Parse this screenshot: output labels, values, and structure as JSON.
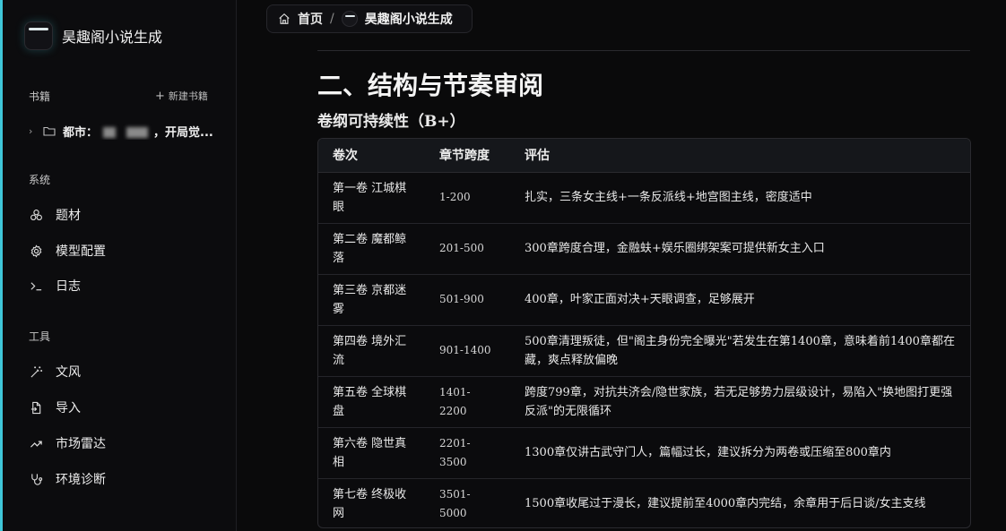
{
  "app": {
    "title": "昊趣阁小说生成"
  },
  "sidebar": {
    "books_label": "书籍",
    "new_book_label": "新建书籍",
    "book": {
      "title_prefix": "都市：",
      "title_suffix": "，开局觉..."
    },
    "system_label": "系统",
    "system_items": [
      {
        "label": "题材",
        "icon": "cube-cluster-icon"
      },
      {
        "label": "模型配置",
        "icon": "gear-icon"
      },
      {
        "label": "日志",
        "icon": "terminal-icon"
      }
    ],
    "tools_label": "工具",
    "tool_items": [
      {
        "label": "文风",
        "icon": "magic-wand-icon"
      },
      {
        "label": "导入",
        "icon": "file-import-icon"
      },
      {
        "label": "市场雷达",
        "icon": "trend-up-icon"
      },
      {
        "label": "环境诊断",
        "icon": "stethoscope-icon"
      }
    ]
  },
  "breadcrumb": {
    "home": "首页",
    "separator": "/",
    "current": "昊趣阁小说生成"
  },
  "content": {
    "heading": "二、结构与节奏审阅",
    "subheading": "卷纲可持续性（B+）",
    "table": {
      "headers": [
        "卷次",
        "章节跨度",
        "评估"
      ],
      "rows": [
        {
          "vol": "第一卷 江城棋眼",
          "span": "1-200",
          "eval": "扎实，三条女主线+一条反派线+地宫图主线，密度适中"
        },
        {
          "vol": "第二卷 魔都鲸落",
          "span": "201-500",
          "eval": "300章跨度合理，金融蚨+娱乐圈绑架案可提供新女主入口"
        },
        {
          "vol": "第三卷 京都迷雾",
          "span": "501-900",
          "eval": "400章，叶家正面对决+天眼调查，足够展开"
        },
        {
          "vol": "第四卷 境外汇流",
          "span": "901-1400",
          "eval": "500章清理叛徒，但\"阁主身份完全曝光\"若发生在第1400章，意味着前1400章都在藏，爽点释放偏晚"
        },
        {
          "vol": "第五卷 全球棋盘",
          "span": "1401-2200",
          "eval": "跨度799章，对抗共济会/隐世家族，若无足够势力层级设计，易陷入\"换地图打更强反派\"的无限循环"
        },
        {
          "vol": "第六卷 隐世真相",
          "span": "2201-3500",
          "eval": "1300章仅讲古武守门人，篇幅过长，建议拆分为两卷或压缩至800章内"
        },
        {
          "vol": "第七卷 终极收网",
          "span": "3501-5000",
          "eval": "1500章收尾过于漫长，建议提前至4000章内完结，余章用于后日谈/女主支线"
        }
      ]
    }
  },
  "colors": {
    "accent": "#3fc6d8",
    "background": "#0a0a0b",
    "sidebar_bg": "#0c0c0e",
    "table_header_bg": "#15171b"
  }
}
